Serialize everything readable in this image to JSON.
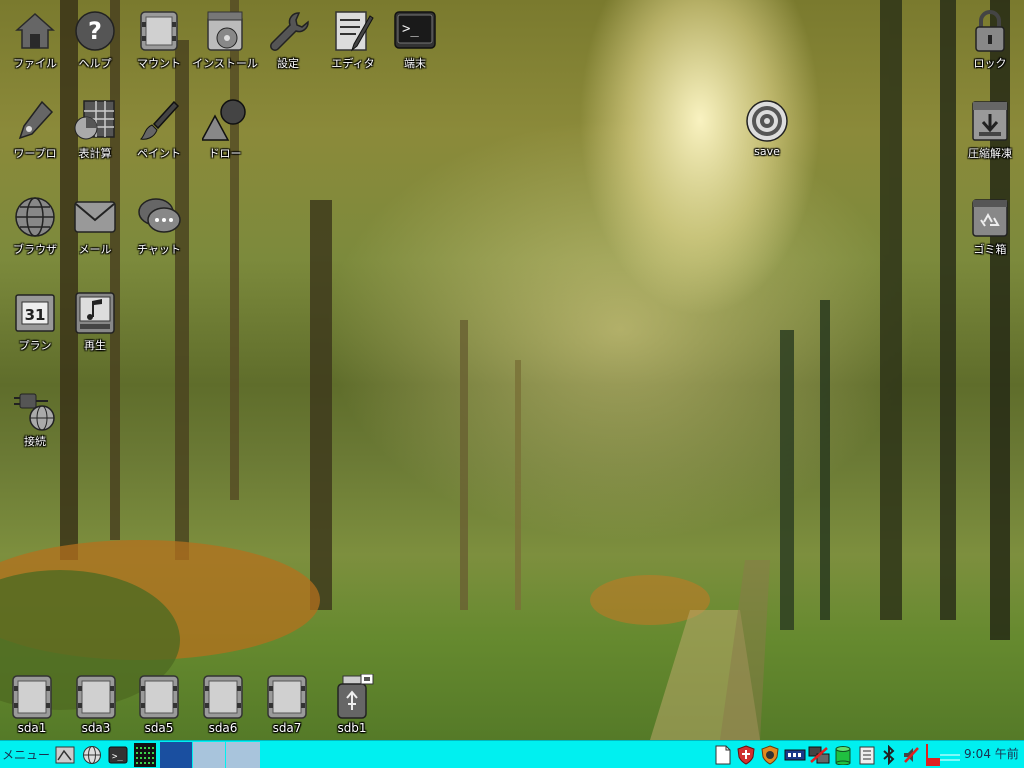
{
  "desktop": {
    "icons": [
      {
        "label": "ファイル",
        "icon": "home-icon"
      },
      {
        "label": "ヘルプ",
        "icon": "help-icon"
      },
      {
        "label": "マウント",
        "icon": "drive-icon"
      },
      {
        "label": "インストール",
        "icon": "install-icon"
      },
      {
        "label": "設定",
        "icon": "wrench-icon"
      },
      {
        "label": "エディタ",
        "icon": "editor-icon"
      },
      {
        "label": "端末",
        "icon": "terminal-icon"
      },
      {
        "label": "ワープロ",
        "icon": "pen-icon"
      },
      {
        "label": "表計算",
        "icon": "spreadsheet-icon"
      },
      {
        "label": "ペイント",
        "icon": "brush-icon"
      },
      {
        "label": "ドロー",
        "icon": "shapes-icon"
      },
      {
        "label": "ブラウザ",
        "icon": "globe-icon"
      },
      {
        "label": "メール",
        "icon": "mail-icon"
      },
      {
        "label": "チャット",
        "icon": "chat-icon"
      },
      {
        "label": "プラン",
        "icon": "calendar-icon"
      },
      {
        "label": "再生",
        "icon": "music-icon"
      },
      {
        "label": "接続",
        "icon": "connect-icon"
      },
      {
        "label": "save",
        "icon": "target-icon"
      },
      {
        "label": "ロック",
        "icon": "lock-icon"
      },
      {
        "label": "圧縮解凍",
        "icon": "archive-icon"
      },
      {
        "label": "ゴミ箱",
        "icon": "trash-icon"
      }
    ],
    "calendar_day": "31",
    "drives": [
      {
        "label": "sda1"
      },
      {
        "label": "sda3"
      },
      {
        "label": "sda5"
      },
      {
        "label": "sda6"
      },
      {
        "label": "sda7"
      },
      {
        "label": "sdb1"
      }
    ]
  },
  "taskbar": {
    "menu_label": "メニュー",
    "quicklaunch": [
      "desktop-icon",
      "globe-icon",
      "terminal-icon",
      "cpu-monitor-icon"
    ],
    "tray": [
      "note-icon",
      "shield-icon",
      "firewall-icon",
      "network-icon",
      "connection-icon",
      "database-icon",
      "clipboard-icon",
      "bluetooth-icon",
      "mute-icon",
      "cpu-graph-icon"
    ],
    "time": "9:04 午前"
  },
  "colors": {
    "taskbar": "#00f0f0",
    "workspace_active": "#1a4fa0",
    "workspace_inactive": "#a8c4dc"
  }
}
